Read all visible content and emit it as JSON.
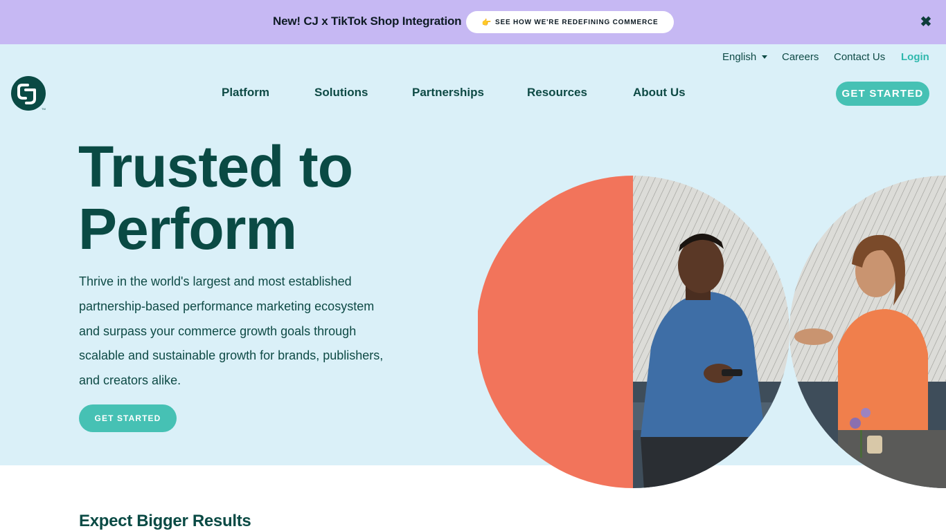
{
  "promo": {
    "text": "New! CJ x TikTok Shop Integration",
    "link_emoji": "👉",
    "link_label": "SEE HOW WE'RE REDEFINING COMMERCE",
    "close_glyph": "✖"
  },
  "utility_nav": {
    "language": "English",
    "careers": "Careers",
    "contact": "Contact Us",
    "login": "Login"
  },
  "main_nav": {
    "items": [
      "Platform",
      "Solutions",
      "Partnerships",
      "Resources",
      "About Us"
    ],
    "cta": "GET STARTED"
  },
  "hero": {
    "title_line1": "Trusted to",
    "title_line2": "Perform",
    "description": "Thrive in the world's largest and most established partnership-based performance marketing ecosystem and surpass your commerce growth goals through scalable and sustainable growth for brands, publishers, and creators alike.",
    "cta": "GET STARTED"
  },
  "next_section": {
    "title": "Expect Bigger Results"
  },
  "colors": {
    "promo_bg": "#c6b8f3",
    "hero_bg": "#daf0f8",
    "brand_dark": "#0a4a44",
    "accent_teal": "#46c1b4",
    "coral": "#f2745b"
  },
  "icons": {
    "logo": "cj-logo-icon",
    "close": "close-icon",
    "language_caret": "chevron-down-icon"
  }
}
